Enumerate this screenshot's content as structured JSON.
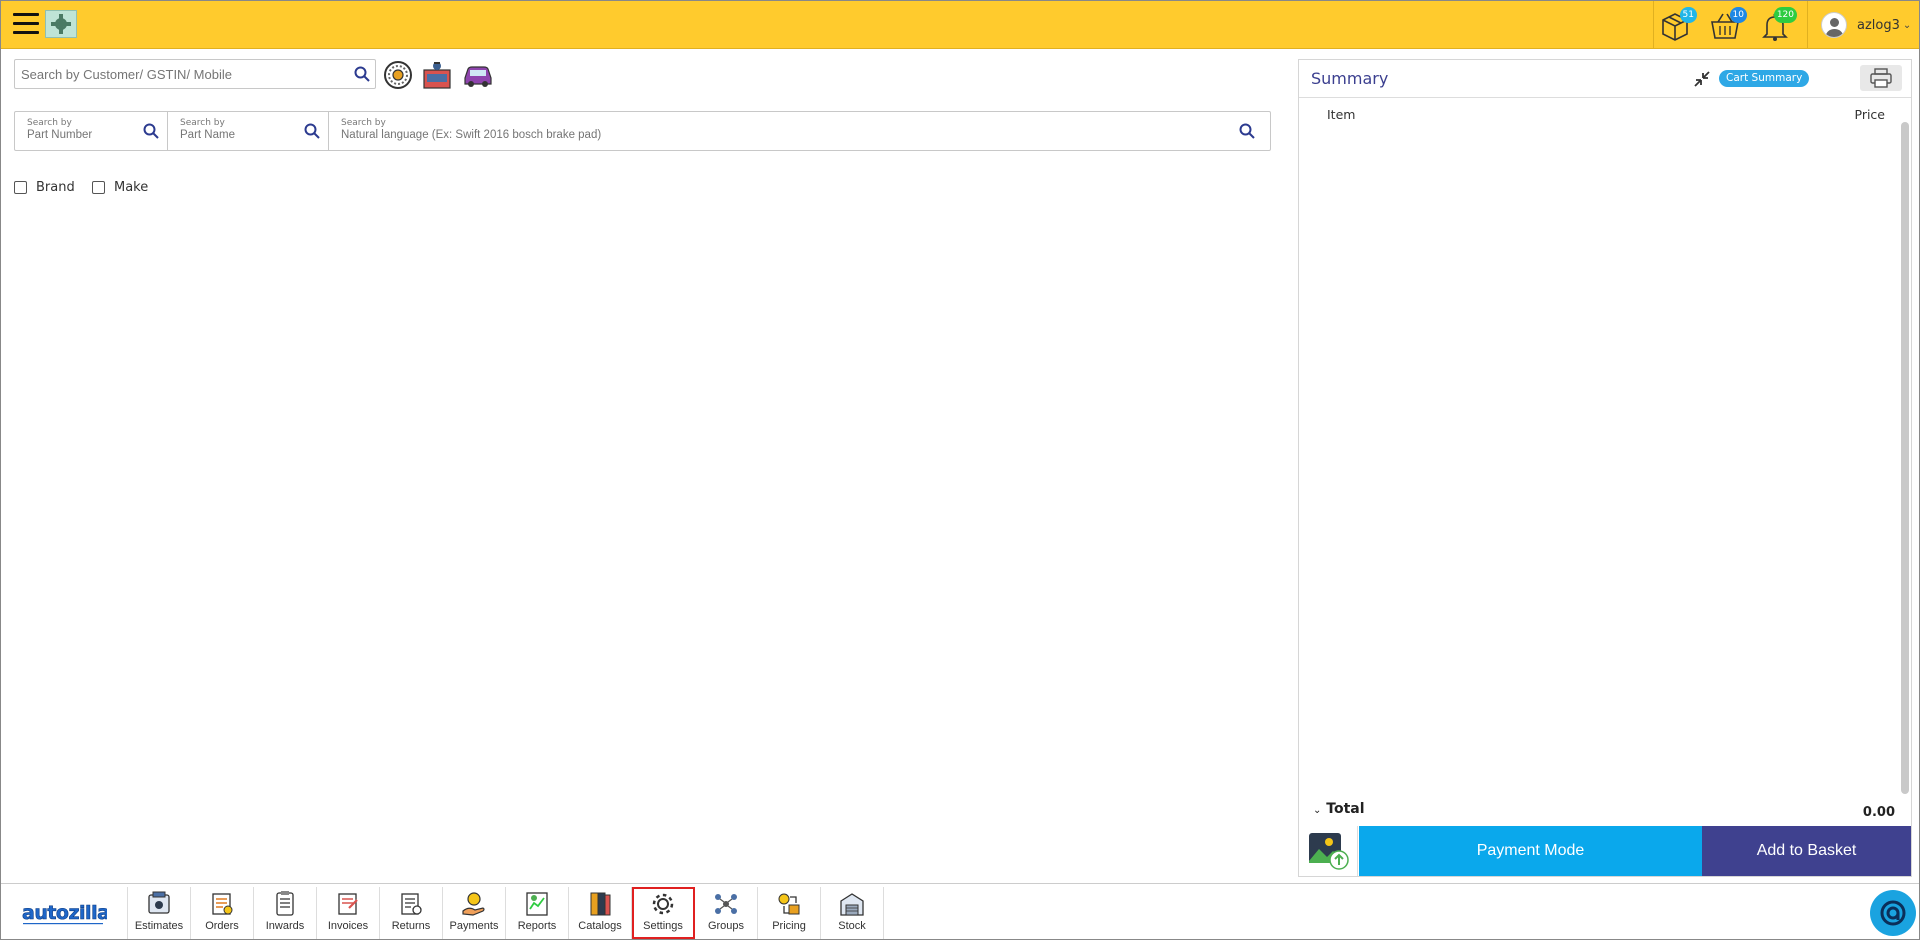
{
  "header": {
    "menu_icon": "hamburger-icon",
    "logo_icon": "app-logo-icon",
    "icons": [
      {
        "name": "package-icon",
        "badge": "51",
        "badge_color": "#21b6e8"
      },
      {
        "name": "basket-icon",
        "badge": "10",
        "badge_color": "#1e88e5"
      },
      {
        "name": "bell-icon",
        "badge": "120",
        "badge_color": "#2ecc40"
      }
    ],
    "username": "azlog3"
  },
  "search": {
    "customer_placeholder": "Search by Customer/ GSTIN/ Mobile",
    "tools": [
      "tyre-icon",
      "garage-icon",
      "car-icon"
    ],
    "part_number": {
      "label": "Search by",
      "placeholder": "Part Number"
    },
    "part_name": {
      "label": "Search by",
      "placeholder": "Part Name"
    },
    "natural": {
      "label": "Search by",
      "placeholder": "Natural language (Ex: Swift 2016 bosch brake pad)"
    }
  },
  "filters": {
    "brand": "Brand",
    "make": "Make"
  },
  "summary": {
    "title": "Summary",
    "cart_summary": "Cart Summary",
    "col_item": "Item",
    "col_price": "Price",
    "total_label": "Total",
    "total_value": "0.00",
    "payment_mode": "Payment Mode",
    "add_to_basket": "Add to Basket"
  },
  "brand": {
    "name": "autozilla"
  },
  "nav": [
    {
      "label": "Estimates",
      "icon": "estimates-icon"
    },
    {
      "label": "Orders",
      "icon": "orders-icon"
    },
    {
      "label": "Inwards",
      "icon": "inwards-icon"
    },
    {
      "label": "Invoices",
      "icon": "invoices-icon"
    },
    {
      "label": "Returns",
      "icon": "returns-icon"
    },
    {
      "label": "Payments",
      "icon": "payments-icon"
    },
    {
      "label": "Reports",
      "icon": "reports-icon"
    },
    {
      "label": "Catalogs",
      "icon": "catalogs-icon"
    },
    {
      "label": "Settings",
      "icon": "settings-icon",
      "active": true
    },
    {
      "label": "Groups",
      "icon": "groups-icon"
    },
    {
      "label": "Pricing",
      "icon": "pricing-icon"
    },
    {
      "label": "Stock",
      "icon": "stock-icon"
    }
  ],
  "colors": {
    "header": "#ffcb2d",
    "accent": "#0aa8ec",
    "basket": "#3f418f",
    "title": "#3b3f8f"
  }
}
